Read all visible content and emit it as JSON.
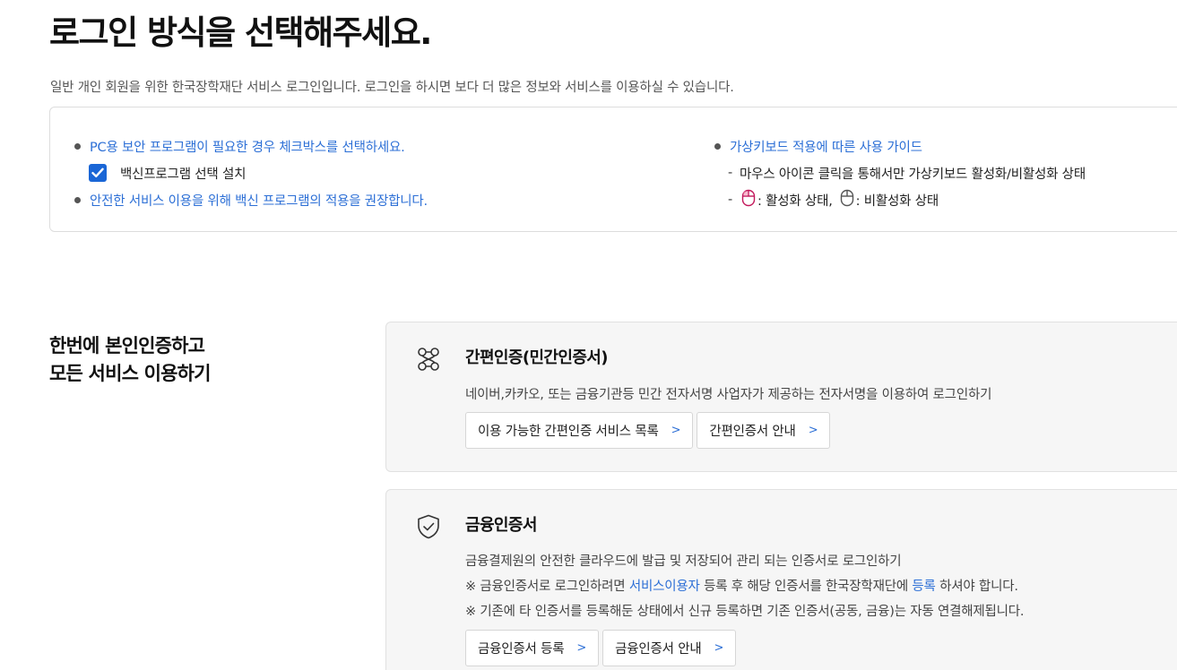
{
  "page": {
    "title": "로그인 방식을 선택해주세요.",
    "description": "일반 개인 회원을 위한 한국장학재단 서비스 로그인입니다. 로그인을 하시면 보다 더 많은 정보와 서비스를 이용하실 수 있습니다."
  },
  "notice": {
    "security_program": "PC용 보안 프로그램이 필요한 경우 체크박스를 선택하세요.",
    "vaccine_checkbox_label": "백신프로그램 선택 설치",
    "vaccine_checked": true,
    "vaccine_recommend": "안전한 서비스 이용을 위해 백신 프로그램의 적용을 권장합니다.",
    "keyboard_guide_title": "가상키보드 적용에 따른 사용 가이드",
    "keyboard_guide_line1": "마우스 아이콘 클릭을 통해서만 가상키보드 활성화/비활성화 상태",
    "keyboard_active_label": ": 활성화 상태,",
    "keyboard_inactive_label": ": 비활성화 상태",
    "dash": "-"
  },
  "section": {
    "title_line1": "한번에 본인인증하고",
    "title_line2": "모든 서비스 이용하기"
  },
  "simple_auth": {
    "icon": "link-nodes-icon",
    "title": "간편인증(민간인증서)",
    "description": "네이버,카카오, 또는 금융기관등 민간 전자서명 사업자가 제공하는 전자서명을 이용하여 로그인하기",
    "buttons": [
      {
        "label": "이용 가능한 간편인증 서비스 목록",
        "arrow": ">"
      },
      {
        "label": "간편인증서 안내",
        "arrow": ">"
      }
    ]
  },
  "financial_cert": {
    "icon": "shield-check-icon",
    "title": "금융인증서",
    "description": "금융결제원의 안전한 클라우드에 발급 및 저장되어 관리 되는 인증서로 로그인하기",
    "note1_pre": "※ 금융인증서로 로그인하려면 ",
    "note1_link1": "서비스이용자",
    "note1_mid": " 등록 후 해당 인증서를 한국장학재단에 ",
    "note1_link2": "등록",
    "note1_post": " 하셔야 합니다.",
    "note2": "※ 기존에 타 인증서를 등록해둔 상태에서 신규 등록하면 기존 인증서(공동, 금융)는 자동 연결해제됩니다.",
    "buttons": [
      {
        "label": "금융인증서 등록",
        "arrow": ">"
      },
      {
        "label": "금융인증서 안내",
        "arrow": ">"
      }
    ]
  },
  "colors": {
    "accent": "#2c6fd6",
    "checkbox": "#1a66d6",
    "card_bg": "#f6f6f6"
  }
}
